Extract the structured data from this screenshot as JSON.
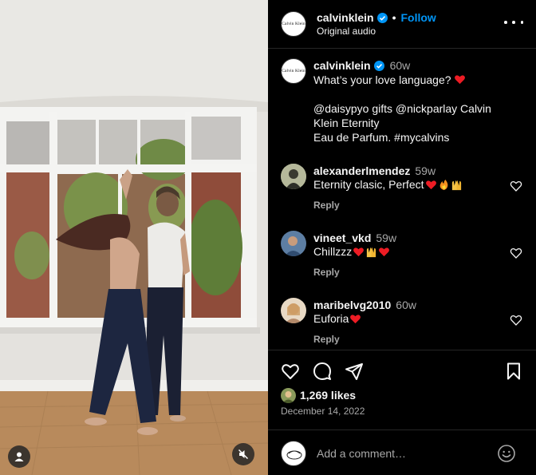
{
  "post": {
    "author": "calvinklein",
    "avatar_text": "Calvin Klein",
    "follow_label": "Follow",
    "separator": "•",
    "audio_label": "Original audio",
    "caption_time": "60w",
    "caption_lines": [
      "What’s your love language?",
      "@daisypyo gifts @nickparlay Calvin",
      "Klein Eternity",
      "Eau de Parfum. #mycalvins"
    ],
    "likes": "1,269 likes",
    "date": "December 14, 2022",
    "add_comment_placeholder": "Add a comment…"
  },
  "comments": [
    {
      "user": "alexanderlmendez",
      "time": "59w",
      "text": "Eternity clasic, Perfect",
      "emojis": [
        "red-heart",
        "fire",
        "raising-hands"
      ],
      "reply": "Reply"
    },
    {
      "user": "vineet_vkd",
      "time": "59w",
      "text": "Chillzzz",
      "emojis": [
        "red-heart",
        "raising-hands",
        "red-heart"
      ],
      "reply": "Reply"
    },
    {
      "user": "maribelvg2010",
      "time": "60w",
      "text": "Euforia",
      "emojis": [
        "red-heart"
      ],
      "reply": "Reply"
    }
  ],
  "colors": {
    "accent": "#0095f6",
    "verified": "#0095f6",
    "heart": "#ed1c24",
    "muted": "#a8a8a8"
  },
  "icons": [
    "more-options-icon",
    "heart-icon",
    "comment-icon",
    "share-icon",
    "bookmark-icon",
    "emoji-icon",
    "mute-icon",
    "user-tag-icon",
    "verified-badge-icon"
  ]
}
